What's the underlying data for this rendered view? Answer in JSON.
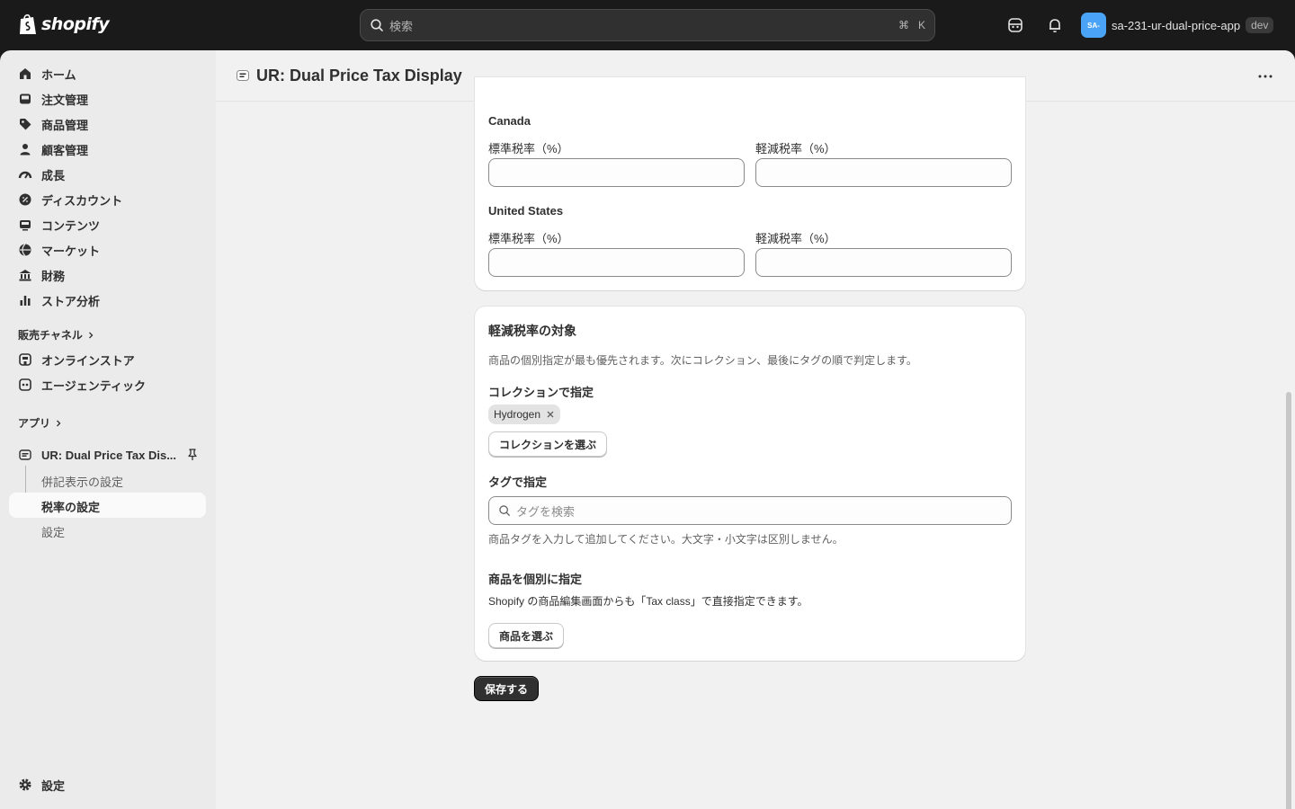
{
  "topbar": {
    "logo_text": "shopify",
    "search_placeholder": "検索",
    "shortcut_cmd": "⌘",
    "shortcut_key": "K",
    "store_avatar": "SA-",
    "store_name": "sa-231-ur-dual-price-app",
    "env_badge": "dev"
  },
  "sidebar": {
    "items": [
      {
        "label": "ホーム",
        "icon": "home-icon"
      },
      {
        "label": "注文管理",
        "icon": "inbox-icon"
      },
      {
        "label": "商品管理",
        "icon": "tag-icon"
      },
      {
        "label": "顧客管理",
        "icon": "person-icon"
      },
      {
        "label": "成長",
        "icon": "gauge-icon"
      },
      {
        "label": "ディスカウント",
        "icon": "discount-icon"
      },
      {
        "label": "コンテンツ",
        "icon": "content-icon"
      },
      {
        "label": "マーケット",
        "icon": "globe-icon"
      },
      {
        "label": "財務",
        "icon": "bank-icon"
      },
      {
        "label": "ストア分析",
        "icon": "chart-icon"
      }
    ],
    "sales_channels_label": "販売チャネル",
    "channels": [
      {
        "label": "オンラインストア",
        "icon": "store-icon"
      },
      {
        "label": "エージェンティック",
        "icon": "agent-icon"
      }
    ],
    "apps_label": "アプリ",
    "app_name": "UR: Dual Price Tax Dis...",
    "app_subitems": [
      "併記表示の設定",
      "税率の設定",
      "設定"
    ],
    "settings_label": "設定"
  },
  "page": {
    "title": "UR: Dual Price Tax Display",
    "countries": [
      {
        "name": "Canada",
        "standard_label": "標準税率（%）",
        "reduced_label": "軽減税率（%）",
        "standard_value": "",
        "reduced_value": ""
      },
      {
        "name": "United States",
        "standard_label": "標準税率（%）",
        "reduced_label": "軽減税率（%）",
        "standard_value": "",
        "reduced_value": ""
      }
    ],
    "reduced_card": {
      "title": "軽減税率の対象",
      "description": "商品の個別指定が最も優先されます。次にコレクション、最後にタグの順で判定します。",
      "collection_heading": "コレクションで指定",
      "collection_chip": "Hydrogen",
      "collection_button": "コレクションを選ぶ",
      "tag_heading": "タグで指定",
      "tag_placeholder": "タグを検索",
      "tag_help": "商品タグを入力して追加してください。大文字・小文字は区別しません。",
      "product_heading": "商品を個別に指定",
      "product_help": "Shopify の商品編集画面からも「Tax class」で直接指定できます。",
      "product_button": "商品を選ぶ"
    },
    "save_button": "保存する"
  }
}
